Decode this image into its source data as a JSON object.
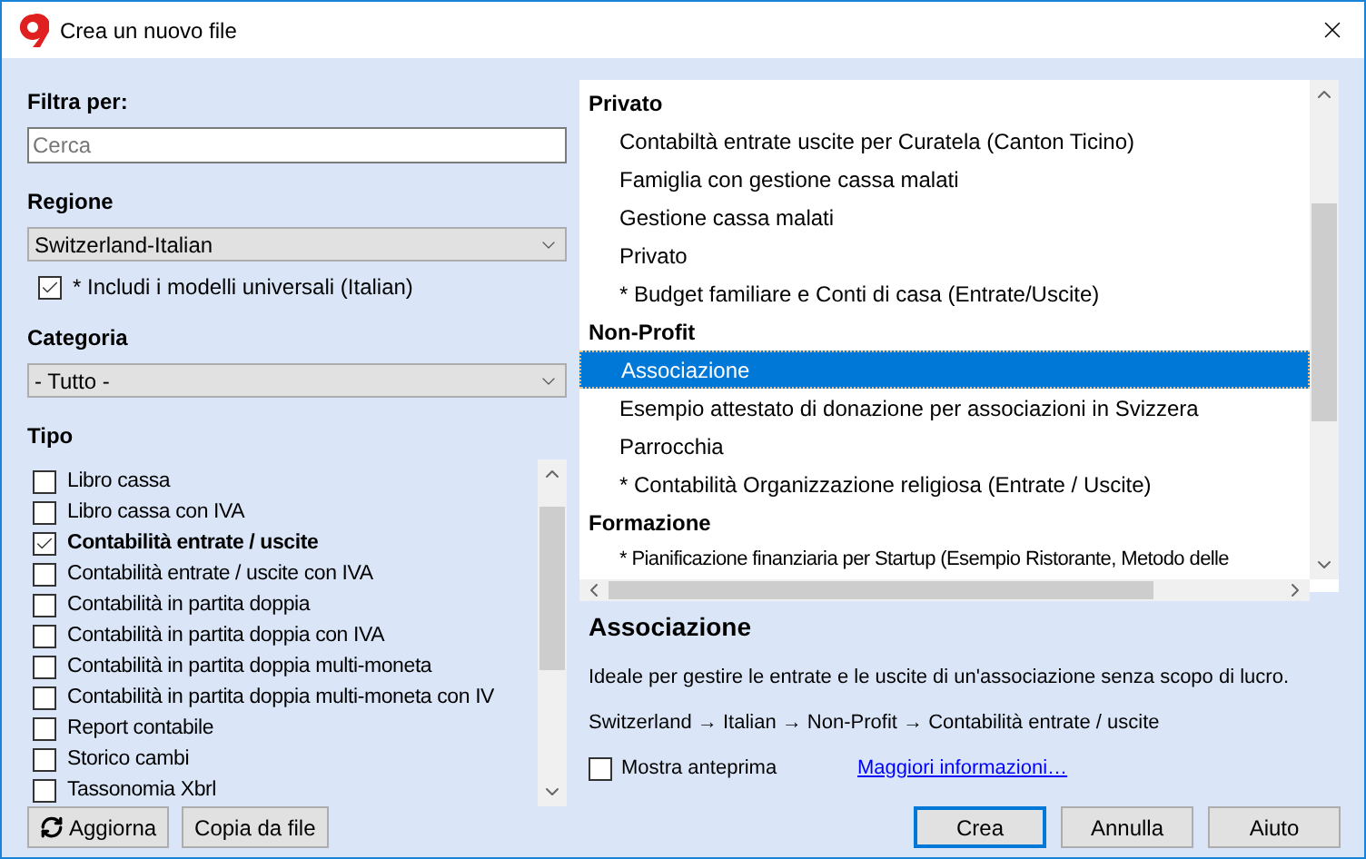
{
  "window": {
    "title": "Crea un nuovo file"
  },
  "filter": {
    "label": "Filtra per:",
    "search": {
      "placeholder": "Cerca"
    }
  },
  "region": {
    "label": "Regione",
    "value": "Switzerland-Italian",
    "include_universal": {
      "label": "* Includi i modelli universali (Italian)",
      "checked": true
    }
  },
  "category": {
    "label": "Categoria",
    "value": "- Tutto -"
  },
  "type": {
    "label": "Tipo",
    "items": [
      {
        "label": "Libro cassa",
        "checked": false
      },
      {
        "label": "Libro cassa con IVA",
        "checked": false
      },
      {
        "label": "Contabilità entrate / uscite",
        "checked": true
      },
      {
        "label": "Contabilità entrate / uscite con IVA",
        "checked": false
      },
      {
        "label": "Contabilità in partita doppia",
        "checked": false
      },
      {
        "label": "Contabilità in partita doppia con IVA",
        "checked": false
      },
      {
        "label": "Contabilità in partita doppia multi-moneta",
        "checked": false
      },
      {
        "label": "Contabilità in partita doppia multi-moneta con IV",
        "checked": false
      },
      {
        "label": "Report contabile",
        "checked": false
      },
      {
        "label": "Storico cambi",
        "checked": false
      },
      {
        "label": "Tassonomia Xbrl",
        "checked": false
      }
    ]
  },
  "left_buttons": [
    {
      "label": "Aggiorna",
      "kind": "refresh"
    },
    {
      "label": "Copia da file",
      "kind": "plain"
    }
  ],
  "templates": {
    "groups": [
      {
        "title": "Privato",
        "items": [
          {
            "label": "Contabiltà entrate uscite per Curatela (Canton Ticino)",
            "selected": false
          },
          {
            "label": "Famiglia con gestione cassa malati",
            "selected": false
          },
          {
            "label": "Gestione cassa malati",
            "selected": false
          },
          {
            "label": "Privato",
            "selected": false
          },
          {
            "label": "* Budget familiare e Conti di casa (Entrate/Uscite)",
            "selected": false
          }
        ]
      },
      {
        "title": "Non-Profit",
        "items": [
          {
            "label": "Associazione",
            "selected": true
          },
          {
            "label": "Esempio attestato di donazione per associazioni in Svizzera",
            "selected": false
          },
          {
            "label": "Parrocchia",
            "selected": false
          },
          {
            "label": "* Contabilità Organizzazione religiosa (Entrate / Uscite)",
            "selected": false
          }
        ]
      },
      {
        "title": "Formazione",
        "items": [
          {
            "label": "* Pianificazione finanziaria per Startup (Esempio Ristorante, Metodo delle",
            "selected": false
          }
        ]
      }
    ]
  },
  "details": {
    "title": "Associazione",
    "description": "Ideale per gestire le entrate e le uscite di un'associazione senza scopo di lucro.",
    "path": "Switzerland → Italian → Non-Profit → Contabilità entrate / uscite",
    "preview": {
      "label": "Mostra anteprima",
      "checked": false
    },
    "link": "Maggiori informazioni…"
  },
  "buttons": [
    {
      "label": "Crea",
      "default": true
    },
    {
      "label": "Annulla",
      "default": false
    },
    {
      "label": "Aiuto",
      "default": false
    }
  ]
}
